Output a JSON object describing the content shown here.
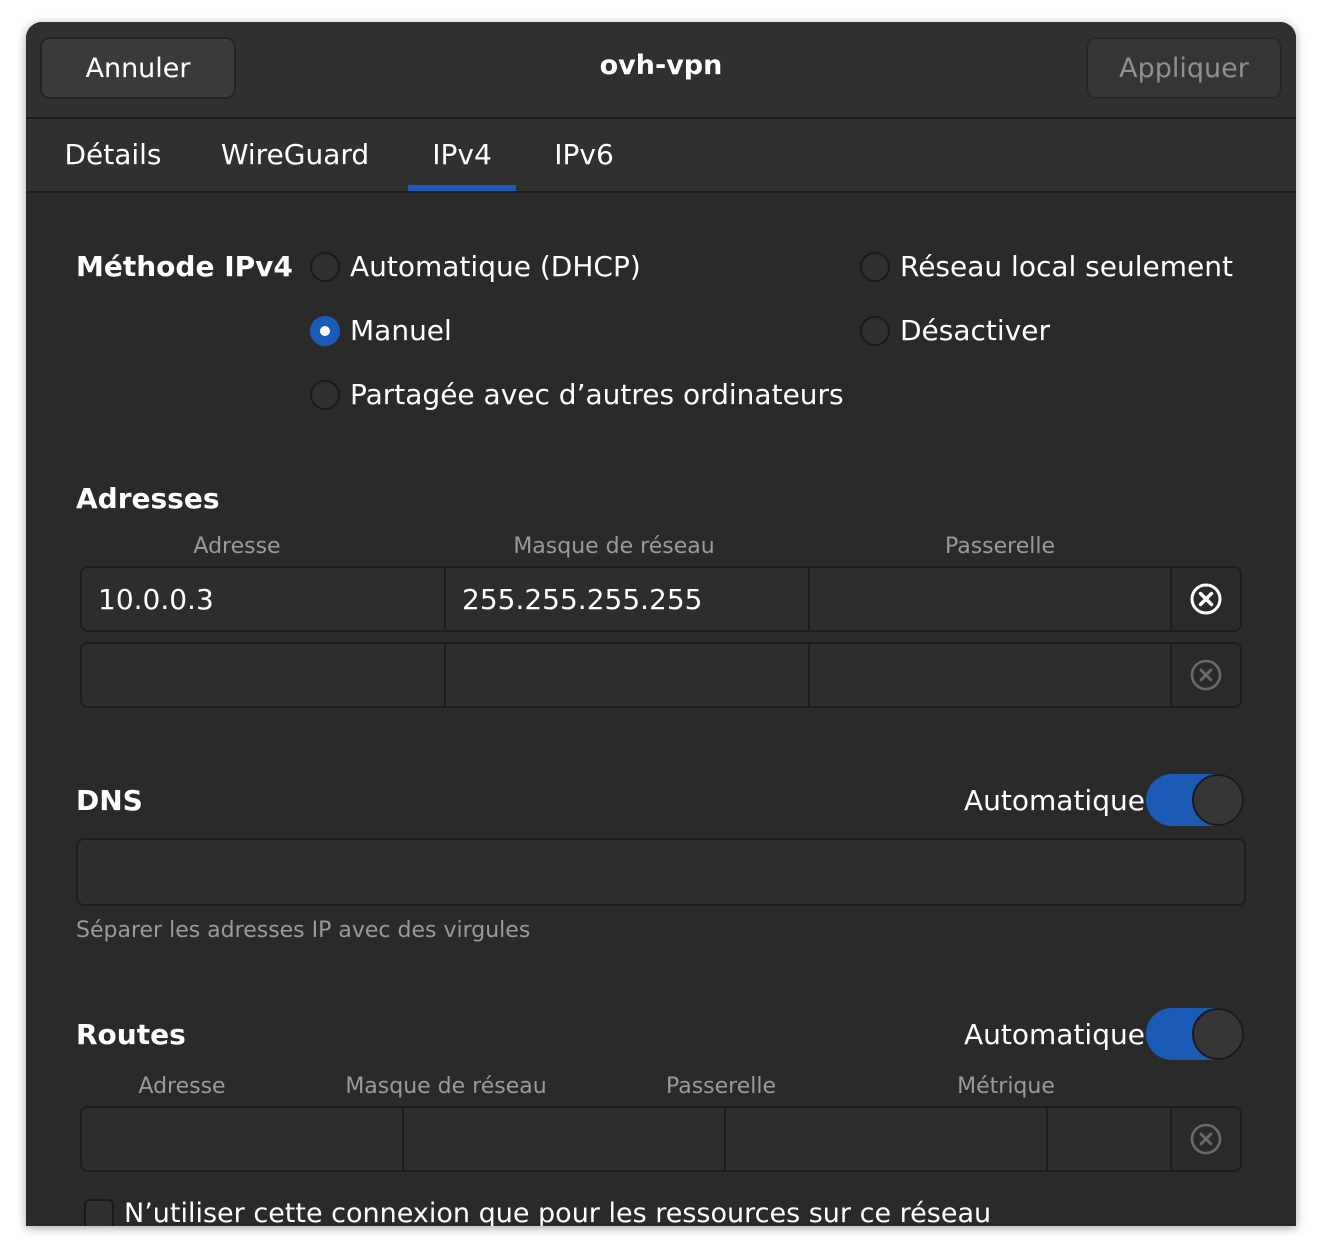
{
  "header": {
    "cancel_label": "Annuler",
    "title": "ovh-vpn",
    "apply_label": "Appliquer"
  },
  "tabs": [
    "Détails",
    "WireGuard",
    "IPv4",
    "IPv6"
  ],
  "active_tab": "IPv4",
  "method": {
    "label": "Méthode IPv4",
    "options": {
      "auto": "Automatique (DHCP)",
      "local": "Réseau local seulement",
      "manual": "Manuel",
      "disable": "Désactiver",
      "shared": "Partagée avec d’autres ordinateurs"
    },
    "selected": "manual"
  },
  "addresses": {
    "label": "Adresses",
    "headers": [
      "Adresse",
      "Masque de réseau",
      "Passerelle"
    ],
    "rows": [
      {
        "address": "10.0.0.3",
        "netmask": "255.255.255.255",
        "gateway": ""
      },
      {
        "address": "",
        "netmask": "",
        "gateway": ""
      }
    ]
  },
  "dns": {
    "label": "DNS",
    "auto_label": "Automatique",
    "auto_on": true,
    "value": "",
    "hint": "Séparer les adresses IP avec des virgules"
  },
  "routes": {
    "label": "Routes",
    "auto_label": "Automatique",
    "auto_on": true,
    "headers": [
      "Adresse",
      "Masque de réseau",
      "Passerelle",
      "Métrique"
    ],
    "rows": [
      {
        "address": "",
        "netmask": "",
        "gateway": "",
        "metric": ""
      }
    ]
  },
  "only_local_label": "N’utiliser cette connexion que pour les ressources sur ce réseau",
  "colors": {
    "accent": "#1c5bb5",
    "window_bg": "#2a2a2a",
    "header_bg": "#303030"
  }
}
